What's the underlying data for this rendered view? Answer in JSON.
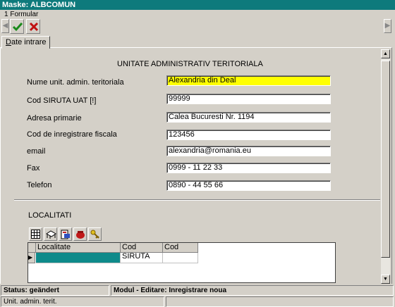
{
  "window": {
    "title": "Maske: ALBCOMUN",
    "subtitle": "1 Formular"
  },
  "toolbar": {
    "ok_icon": "checkmark-icon",
    "cancel_icon": "x-icon",
    "ok_color": "#1a8a1a",
    "cancel_color": "#c01010",
    "nav_left": "◀",
    "nav_right": "▶"
  },
  "tabs": [
    {
      "label": "Date intrare",
      "underline": "D",
      "rest": "ate intrare"
    }
  ],
  "form": {
    "section_title": "UNITATE ADMINISTRATIV TERITORIALA",
    "fields": [
      {
        "label": "Nume unit. admin. teritoriala",
        "value": "Alexandria din Deal"
      },
      {
        "label": "Cod SIRUTA UAT [!]",
        "value": "99999"
      },
      {
        "label": "Adresa primarie",
        "value": "Calea Bucuresti Nr. 1194"
      },
      {
        "label": "Cod de inregistrare fiscala",
        "value": "123456"
      },
      {
        "label": "email",
        "value": "alexandria@romania.eu"
      },
      {
        "label": "Fax",
        "value": "0999 - 11 22 33"
      },
      {
        "label": "Telefon",
        "value": "0890 -  44 55 66"
      }
    ]
  },
  "localitati": {
    "title": "LOCALITATI",
    "toolbar_icons": [
      "table-icon",
      "edit-table-icon",
      "export-icon",
      "delete-icon",
      "key-icon"
    ],
    "columns": [
      "Localitate",
      "Cod SIRUTA",
      "Cod"
    ],
    "row_indicator": "▶"
  },
  "status": {
    "status_text": "Status: geändert",
    "modul_text": "Modul - Editare: Inregistrare noua",
    "field_hint": "Unit. admin. terit."
  },
  "colors": {
    "titlebar": "#0e7a7c",
    "focus_field": "#ffff00",
    "grid_selected": "#0e8a8a"
  }
}
